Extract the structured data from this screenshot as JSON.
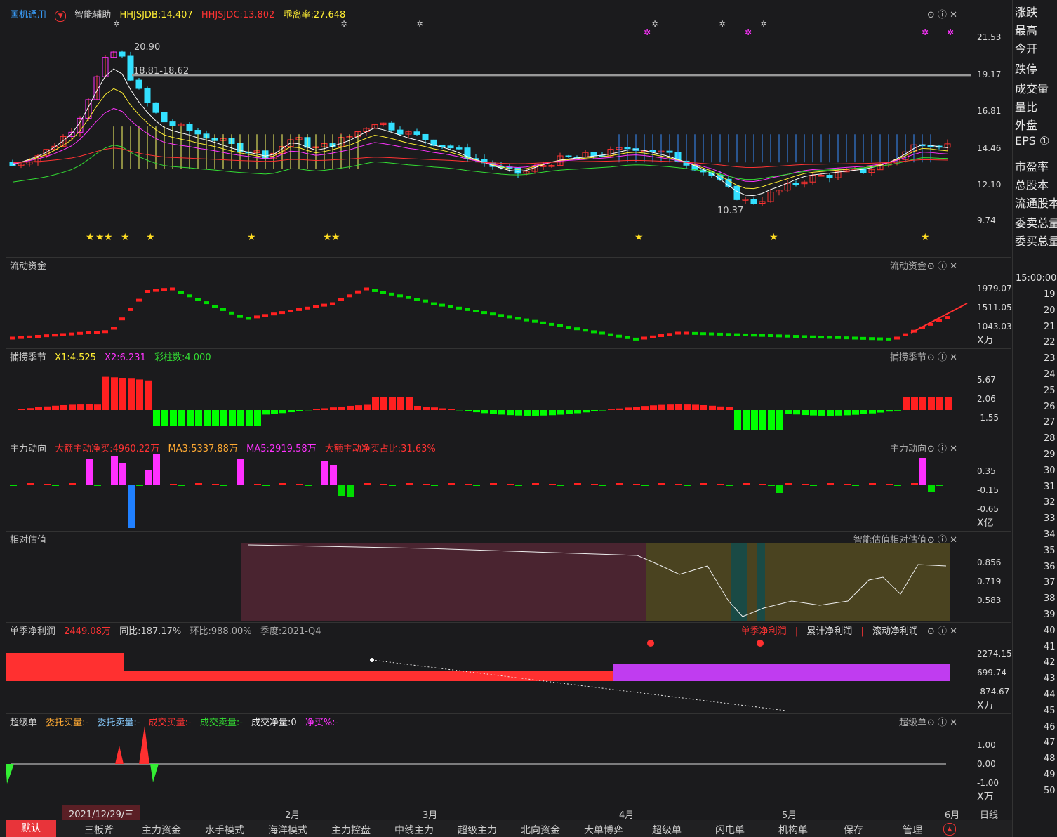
{
  "top": {
    "stock_name": "国机通用",
    "indicator": "智能辅助",
    "hhjsjdb": "HHJSJDB:14.407",
    "hhjsjdc": "HHJSJDC:13.802",
    "deviation": "乖离率:27.648",
    "price_axis": [
      "21.53",
      "19.17",
      "16.81",
      "14.46",
      "12.10",
      "9.74"
    ],
    "high_label": "20.90",
    "range_label": "18.81-18.62",
    "low_label": "10.37"
  },
  "p1": {
    "title": "流动资金",
    "right": "流动资金",
    "axis": [
      "1979.07",
      "1511.05",
      "1043.03",
      "X万"
    ]
  },
  "p2": {
    "title": "捕捞季节",
    "x1": "X1:4.525",
    "x2": "X2:6.231",
    "bars": "彩柱数:4.000",
    "right": "捕捞季节",
    "axis": [
      "5.67",
      "2.06",
      "-1.55"
    ]
  },
  "p3": {
    "title": "主力动向",
    "a": "大额主动净买:4960.22万",
    "b": "MA3:5337.88万",
    "c": "MA5:2919.58万",
    "d": "大额主动净买占比:31.63%",
    "right": "主力动向",
    "axis": [
      "0.35",
      "-0.15",
      "-0.65",
      "X亿"
    ]
  },
  "p4": {
    "title": "相对估值",
    "right": "智能估值相对估值",
    "axis": [
      "0.856",
      "0.719",
      "0.583"
    ]
  },
  "p5": {
    "title": "单季净利润",
    "v": "2449.08万",
    "yoy": "同比:187.17%",
    "qoq": "环比:988.00%",
    "q": "季度:2021-Q4",
    "t1": "单季净利润",
    "t2": "累计净利润",
    "t3": "滚动净利润",
    "axis": [
      "2274.15",
      "699.74",
      "-874.67",
      "X万"
    ]
  },
  "p6": {
    "title": "超级单",
    "a": "委托买量:-",
    "b": "委托卖量:-",
    "c": "成交买量:-",
    "d": "成交卖量:-",
    "e": "成交净量:0",
    "f": "净买%:-",
    "right": "超级单",
    "axis": [
      "1.00",
      "0.00",
      "-1.00",
      "X万"
    ]
  },
  "xaxis": {
    "cursor": "2021/12/29/三",
    "months": [
      "2月",
      "3月",
      "4月",
      "5月",
      "6月"
    ],
    "dayline": "日线"
  },
  "tabs": [
    "默认",
    "三板斧",
    "主力资金",
    "水手模式",
    "海洋模式",
    "主力控盘",
    "中线主力",
    "超级主力",
    "北向资金",
    "大单博弈",
    "超级单",
    "闪电单",
    "机构单",
    "保存",
    "管理"
  ],
  "right_panel": {
    "labels": [
      "涨跌",
      "最高",
      "今开",
      "跌停",
      "成交量",
      "量比",
      "外盘",
      "EPS ①",
      "市盈率",
      "总股本",
      "流通股本",
      "委卖总量",
      "委买总量"
    ],
    "time": "15:00:00",
    "minutes": [
      "19",
      "20",
      "21",
      "22",
      "23",
      "24",
      "25",
      "26",
      "27",
      "28",
      "29",
      "30",
      "31",
      "32",
      "33",
      "34",
      "35",
      "36",
      "37",
      "38",
      "39",
      "40",
      "41",
      "42",
      "43",
      "44",
      "45",
      "46",
      "47",
      "48",
      "49",
      "50"
    ]
  },
  "colors": {
    "up": "#ff3030",
    "down": "#33e0ff",
    "green": "#00dd00",
    "magenta": "#ff00ff",
    "yellow": "#ffff44"
  }
}
